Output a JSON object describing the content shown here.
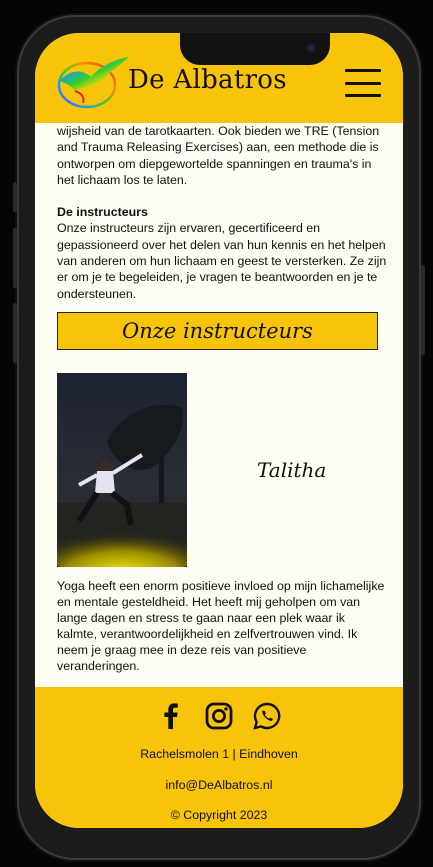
{
  "header": {
    "brand": "De Albatros",
    "logo_icon": "albatross-logo-icon",
    "menu_icon": "hamburger-menu-icon"
  },
  "content": {
    "intro_text": "wijsheid van de tarotkaarten. Ook bieden we TRE (Tension and Trauma Releasing Exercises) aan, een methode die is ontworpen om diepgewortelde spanningen en trauma's in het lichaam los te laten.",
    "instructors_heading": "De instructeurs",
    "instructors_text": "Onze instructeurs zijn ervaren, gecertificeerd en gepassioneerd over het delen van hun kennis en het helpen van anderen om hun lichaam en geest te versterken. Ze zijn er om je te begeleiden, je vragen te beantwoorden en je te ondersteunen."
  },
  "section": {
    "title": "Onze instructeurs"
  },
  "instructor": {
    "name": "Talitha",
    "bio": "Yoga heeft een enorm positieve invloed op mijn lichamelijke en mentale gesteldheid. Het heeft mij geholpen om van lange dagen en stress te gaan naar een plek waar ik kalmte, verantwoordelijkheid en zelfvertrouwen vind. Ik neem je graag mee in deze reis van positieve veranderingen."
  },
  "footer": {
    "social": [
      "facebook-icon",
      "instagram-icon",
      "whatsapp-icon"
    ],
    "address": "Rachelsmolen 1 | Eindhoven",
    "email": "info@DeAlbatros.nl",
    "copyright": "© Copyright 2023"
  },
  "colors": {
    "accent": "#f8c409",
    "background": "#fdfdf3",
    "text": "#111111"
  }
}
